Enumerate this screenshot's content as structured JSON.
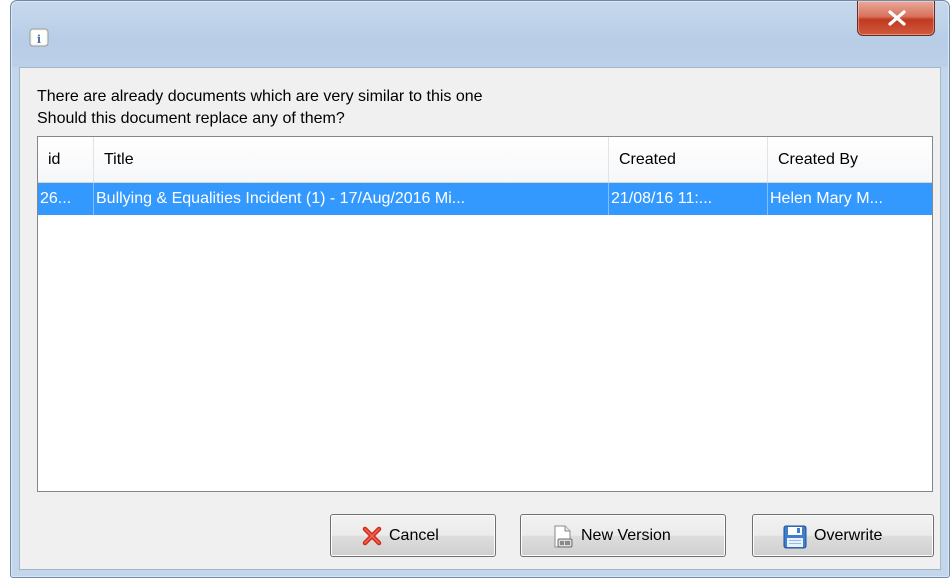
{
  "window": {
    "icon": "info-dialog-icon",
    "close_icon": "close-icon",
    "accent_close": "#c1391f"
  },
  "message": {
    "line1": "There are already documents which are very similar to this one",
    "line2": "Should this document replace any of them?"
  },
  "table": {
    "columns": [
      "id",
      "Title",
      "Created",
      "Created By"
    ],
    "rows": [
      {
        "id": "26...",
        "title": "Bullying & Equalities Incident (1) - 17/Aug/2016 Mi...",
        "created": "21/08/16 11:...",
        "created_by": "Helen Mary M...",
        "selected": true
      }
    ],
    "selection_color": "#3399ff"
  },
  "buttons": {
    "cancel": {
      "label": "Cancel",
      "icon": "red-x-icon"
    },
    "new_version": {
      "label": "New Version",
      "icon": "document-copy-icon"
    },
    "overwrite": {
      "label": "Overwrite",
      "icon": "floppy-disk-icon"
    }
  }
}
